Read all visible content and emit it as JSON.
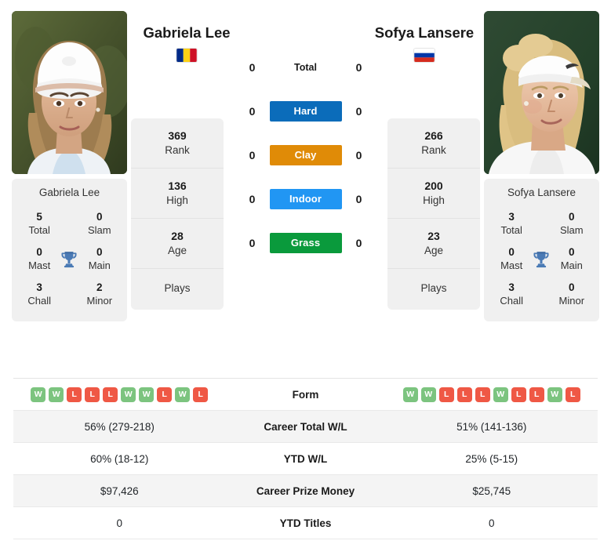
{
  "players": {
    "left": {
      "name": "Gabriela Lee",
      "flag": "romania-flag",
      "card_name": "Gabriela Lee",
      "titles": {
        "total_value": "5",
        "total_label": "Total",
        "slam_value": "0",
        "slam_label": "Slam",
        "mast_value": "0",
        "mast_label": "Mast",
        "main_value": "0",
        "main_label": "Main",
        "chall_value": "3",
        "chall_label": "Chall",
        "minor_value": "2",
        "minor_label": "Minor"
      },
      "stats": {
        "rank_value": "369",
        "rank_label": "Rank",
        "high_value": "136",
        "high_label": "High",
        "age_value": "28",
        "age_label": "Age",
        "plays_value": "",
        "plays_label": "Plays"
      },
      "form": [
        "W",
        "W",
        "L",
        "L",
        "L",
        "W",
        "W",
        "L",
        "W",
        "L"
      ],
      "career_total_wl": "56% (279-218)",
      "ytd_wl": "60% (18-12)",
      "career_prize_money": "$97,426",
      "ytd_titles": "0"
    },
    "right": {
      "name": "Sofya Lansere",
      "flag": "russia-flag",
      "card_name": "Sofya Lansere",
      "titles": {
        "total_value": "3",
        "total_label": "Total",
        "slam_value": "0",
        "slam_label": "Slam",
        "mast_value": "0",
        "mast_label": "Mast",
        "main_value": "0",
        "main_label": "Main",
        "chall_value": "3",
        "chall_label": "Chall",
        "minor_value": "0",
        "minor_label": "Minor"
      },
      "stats": {
        "rank_value": "266",
        "rank_label": "Rank",
        "high_value": "200",
        "high_label": "High",
        "age_value": "23",
        "age_label": "Age",
        "plays_value": "",
        "plays_label": "Plays"
      },
      "form": [
        "W",
        "W",
        "L",
        "L",
        "L",
        "W",
        "L",
        "L",
        "W",
        "L"
      ],
      "career_total_wl": "51% (141-136)",
      "ytd_wl": "25% (5-15)",
      "career_prize_money": "$25,745",
      "ytd_titles": "0"
    }
  },
  "head_to_head": {
    "rows": [
      {
        "label": "Total",
        "left": "0",
        "right": "0",
        "badge": false,
        "color": ""
      },
      {
        "label": "Hard",
        "left": "0",
        "right": "0",
        "badge": true,
        "color": "#0b6cba"
      },
      {
        "label": "Clay",
        "left": "0",
        "right": "0",
        "badge": true,
        "color": "#e08b07"
      },
      {
        "label": "Indoor",
        "left": "0",
        "right": "0",
        "badge": true,
        "color": "#2196f3"
      },
      {
        "label": "Grass",
        "left": "0",
        "right": "0",
        "badge": true,
        "color": "#0a9a3c"
      }
    ]
  },
  "comparison_table": {
    "rows": [
      {
        "label": "Form"
      },
      {
        "label": "Career Total W/L"
      },
      {
        "label": "YTD W/L"
      },
      {
        "label": "Career Prize Money"
      },
      {
        "label": "YTD Titles"
      }
    ]
  },
  "icons": {
    "trophy": "trophy-icon"
  },
  "colors": {
    "win": "#7cc47f",
    "loss": "#ef5845",
    "hard": "#0b6cba",
    "clay": "#e08b07",
    "indoor": "#2196f3",
    "grass": "#0a9a3c",
    "card_bg": "#f0f0f0"
  }
}
